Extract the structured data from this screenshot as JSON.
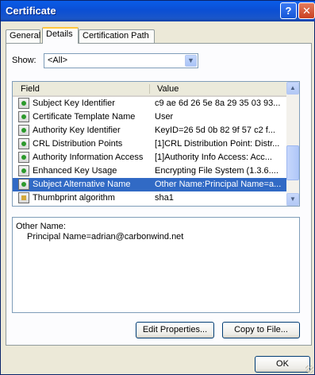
{
  "window": {
    "title": "Certificate"
  },
  "titlebar": {
    "help_glyph": "?",
    "close_glyph": "✕"
  },
  "tabs": [
    {
      "label": "General"
    },
    {
      "label": "Details"
    },
    {
      "label": "Certification Path"
    }
  ],
  "show": {
    "label": "Show:",
    "value": "<All>"
  },
  "list": {
    "columns": [
      "Field",
      "Value"
    ],
    "rows": [
      {
        "field": "Subject Key Identifier",
        "value": "c9 ae 6d 26 5e 8a 29 35 03 93...",
        "icon": "certificate-field-icon"
      },
      {
        "field": "Certificate Template Name",
        "value": "User",
        "icon": "certificate-field-icon"
      },
      {
        "field": "Authority Key Identifier",
        "value": "KeyID=26 5d 0b 82 9f 57 c2 f...",
        "icon": "certificate-field-icon"
      },
      {
        "field": "CRL Distribution Points",
        "value": "[1]CRL Distribution Point: Distr...",
        "icon": "certificate-field-icon"
      },
      {
        "field": "Authority Information Access",
        "value": "[1]Authority Info Access: Acc...",
        "icon": "certificate-field-icon"
      },
      {
        "field": "Enhanced Key Usage",
        "value": "Encrypting File System (1.3.6....",
        "icon": "certificate-field-icon"
      },
      {
        "field": "Subject Alternative Name",
        "value": "Other Name:Principal Name=a...",
        "icon": "certificate-field-icon",
        "selected": true
      },
      {
        "field": "Thumbprint algorithm",
        "value": "sha1",
        "icon": "thumbprint-icon"
      }
    ]
  },
  "detail": {
    "line1": "Other Name:",
    "line2": "Principal Name=adrian@carbonwind.net"
  },
  "buttons": {
    "edit": "Edit Properties...",
    "copy": "Copy to File...",
    "ok": "OK"
  }
}
